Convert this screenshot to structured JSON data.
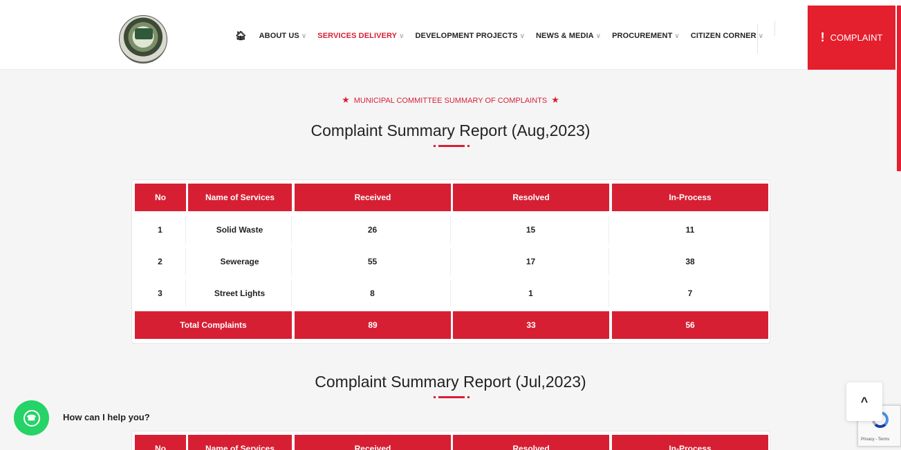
{
  "nav": {
    "home_icon": "home-icon",
    "items": [
      {
        "label": "ABOUT US",
        "chevron": "∨"
      },
      {
        "label": "SERVICES DELIVERY",
        "chevron": "∨"
      },
      {
        "label": "DEVELOPMENT PROJECTS",
        "chevron": "∨"
      },
      {
        "label": "NEWS & MEDIA",
        "chevron": "∨"
      },
      {
        "label": "PROCUREMENT",
        "chevron": "∨"
      },
      {
        "label": "CITIZEN CORNER",
        "chevron": "∨"
      }
    ],
    "active_index": 1,
    "complaint_label": "COMPLAINT"
  },
  "colors": {
    "accent": "#d71f33",
    "complaint_bg": "#e41f2e",
    "whatsapp": "#25d366"
  },
  "section_subtitle": "MUNICIPAL COMMITTEE SUMMARY OF COMPLAINTS",
  "reports": [
    {
      "title": "Complaint Summary Report (Aug,2023)",
      "headers": [
        "No",
        "Name of Services",
        "Received",
        "Resolved",
        "In-Process"
      ],
      "rows": [
        [
          "1",
          "Solid Waste",
          "26",
          "15",
          "11"
        ],
        [
          "2",
          "Sewerage",
          "55",
          "17",
          "38"
        ],
        [
          "3",
          "Street Lights",
          "8",
          "1",
          "7"
        ]
      ],
      "total": [
        "Total Complaints",
        "89",
        "33",
        "56"
      ]
    },
    {
      "title": "Complaint Summary Report (Jul,2023)",
      "headers": [
        "No",
        "Name of Services",
        "Received",
        "Resolved",
        "In-Process"
      ]
    }
  ],
  "whatsapp": {
    "icon": "whatsapp-icon",
    "help_text": "How can I help you?"
  },
  "scroll_top": {
    "icon": "chevron-up-icon",
    "glyph": "^"
  },
  "recaptcha": {
    "text": "Privacy - Terms"
  }
}
